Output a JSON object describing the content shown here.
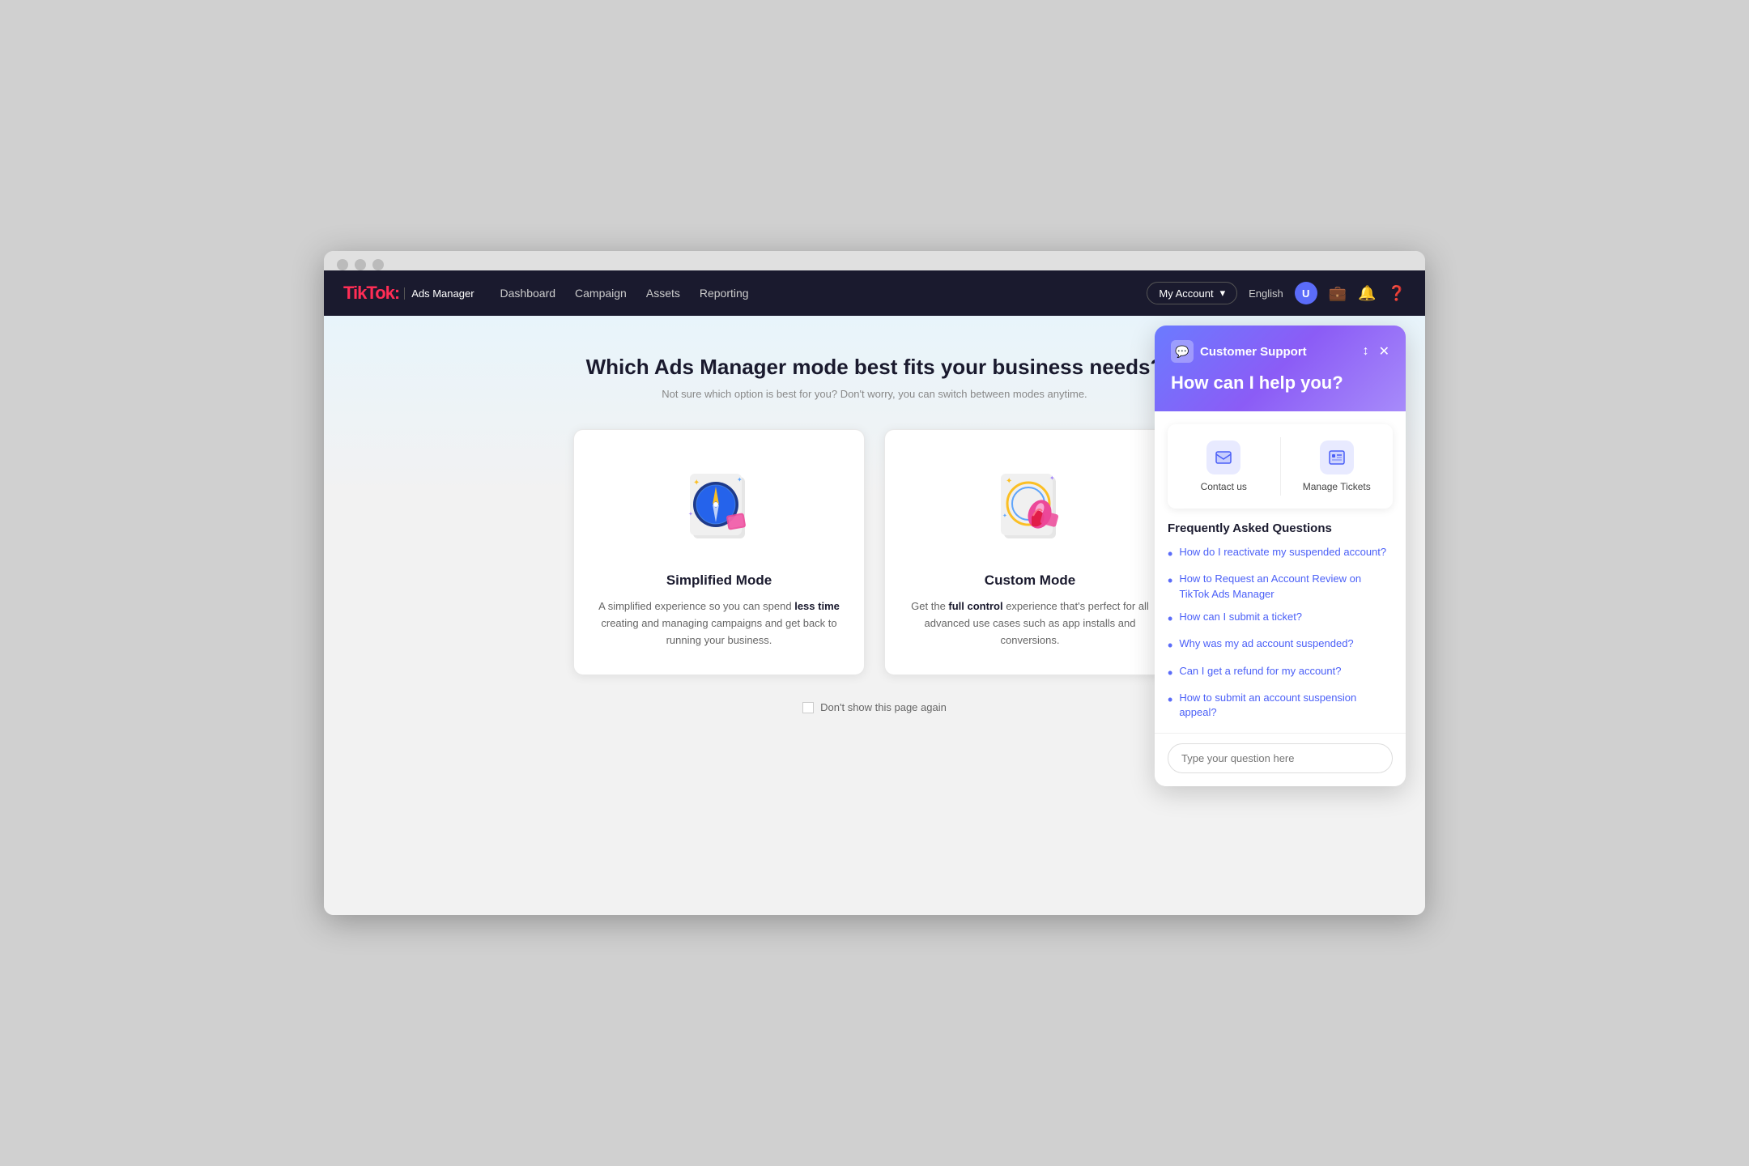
{
  "browser": {
    "dots": [
      "dot1",
      "dot2",
      "dot3"
    ]
  },
  "navbar": {
    "brand": "TikTok",
    "brand_accent": ":",
    "ads_manager": "Ads Manager",
    "nav_items": [
      "Dashboard",
      "Campaign",
      "Assets",
      "Reporting"
    ],
    "account_label": "My Account",
    "lang": "English",
    "user_initial": "U"
  },
  "main": {
    "title": "Which Ads Manager mode best fits your business needs?",
    "subtitle": "Not sure which option is best for you? Don't worry, you can switch between modes anytime.",
    "cards": [
      {
        "id": "simplified",
        "title": "Simplified Mode",
        "desc_prefix": "A simplified experience so you can spend ",
        "desc_bold": "less time",
        "desc_suffix": " creating and managing campaigns and get back to running your business."
      },
      {
        "id": "custom",
        "title": "Custom Mode",
        "desc_prefix": "Get the ",
        "desc_bold": "full control",
        "desc_suffix": " experience that's perfect for all advanced use cases such as app installs and conversions."
      }
    ],
    "dont_show_label": "Don't show this page again"
  },
  "support": {
    "brand": "Customer Support",
    "title": "How can I help you?",
    "actions": [
      {
        "label": "Contact us",
        "icon": "💬"
      },
      {
        "label": "Manage Tickets",
        "icon": "🎫"
      }
    ],
    "faq_title": "Frequently Asked Questions",
    "faq_items": [
      "How do I reactivate my suspended account?",
      "How to Request an Account Review on TikTok Ads Manager",
      "How can I submit a ticket?",
      "Why was my ad account suspended?",
      "Can I get a refund for my account?",
      "How to submit an account suspension appeal?"
    ],
    "input_placeholder": "Type your question here"
  }
}
